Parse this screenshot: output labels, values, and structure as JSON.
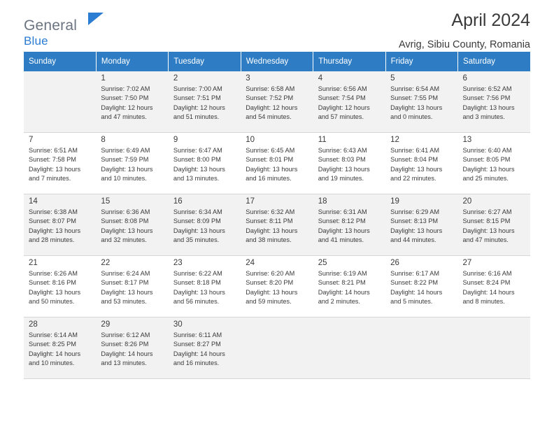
{
  "brand": {
    "name_part1": "General",
    "name_part2": "Blue",
    "flag_icon": "blue-flag-icon"
  },
  "header": {
    "title": "April 2024",
    "location": "Avrig, Sibiu County, Romania"
  },
  "calendar": {
    "weekday_headers": [
      "Sunday",
      "Monday",
      "Tuesday",
      "Wednesday",
      "Thursday",
      "Friday",
      "Saturday"
    ],
    "header_color": "#2e7dc4",
    "weeks": [
      [
        {
          "day": "",
          "info": ""
        },
        {
          "day": "1",
          "info": "Sunrise: 7:02 AM\nSunset: 7:50 PM\nDaylight: 12 hours\nand 47 minutes."
        },
        {
          "day": "2",
          "info": "Sunrise: 7:00 AM\nSunset: 7:51 PM\nDaylight: 12 hours\nand 51 minutes."
        },
        {
          "day": "3",
          "info": "Sunrise: 6:58 AM\nSunset: 7:52 PM\nDaylight: 12 hours\nand 54 minutes."
        },
        {
          "day": "4",
          "info": "Sunrise: 6:56 AM\nSunset: 7:54 PM\nDaylight: 12 hours\nand 57 minutes."
        },
        {
          "day": "5",
          "info": "Sunrise: 6:54 AM\nSunset: 7:55 PM\nDaylight: 13 hours\nand 0 minutes."
        },
        {
          "day": "6",
          "info": "Sunrise: 6:52 AM\nSunset: 7:56 PM\nDaylight: 13 hours\nand 3 minutes."
        }
      ],
      [
        {
          "day": "7",
          "info": "Sunrise: 6:51 AM\nSunset: 7:58 PM\nDaylight: 13 hours\nand 7 minutes."
        },
        {
          "day": "8",
          "info": "Sunrise: 6:49 AM\nSunset: 7:59 PM\nDaylight: 13 hours\nand 10 minutes."
        },
        {
          "day": "9",
          "info": "Sunrise: 6:47 AM\nSunset: 8:00 PM\nDaylight: 13 hours\nand 13 minutes."
        },
        {
          "day": "10",
          "info": "Sunrise: 6:45 AM\nSunset: 8:01 PM\nDaylight: 13 hours\nand 16 minutes."
        },
        {
          "day": "11",
          "info": "Sunrise: 6:43 AM\nSunset: 8:03 PM\nDaylight: 13 hours\nand 19 minutes."
        },
        {
          "day": "12",
          "info": "Sunrise: 6:41 AM\nSunset: 8:04 PM\nDaylight: 13 hours\nand 22 minutes."
        },
        {
          "day": "13",
          "info": "Sunrise: 6:40 AM\nSunset: 8:05 PM\nDaylight: 13 hours\nand 25 minutes."
        }
      ],
      [
        {
          "day": "14",
          "info": "Sunrise: 6:38 AM\nSunset: 8:07 PM\nDaylight: 13 hours\nand 28 minutes."
        },
        {
          "day": "15",
          "info": "Sunrise: 6:36 AM\nSunset: 8:08 PM\nDaylight: 13 hours\nand 32 minutes."
        },
        {
          "day": "16",
          "info": "Sunrise: 6:34 AM\nSunset: 8:09 PM\nDaylight: 13 hours\nand 35 minutes."
        },
        {
          "day": "17",
          "info": "Sunrise: 6:32 AM\nSunset: 8:11 PM\nDaylight: 13 hours\nand 38 minutes."
        },
        {
          "day": "18",
          "info": "Sunrise: 6:31 AM\nSunset: 8:12 PM\nDaylight: 13 hours\nand 41 minutes."
        },
        {
          "day": "19",
          "info": "Sunrise: 6:29 AM\nSunset: 8:13 PM\nDaylight: 13 hours\nand 44 minutes."
        },
        {
          "day": "20",
          "info": "Sunrise: 6:27 AM\nSunset: 8:15 PM\nDaylight: 13 hours\nand 47 minutes."
        }
      ],
      [
        {
          "day": "21",
          "info": "Sunrise: 6:26 AM\nSunset: 8:16 PM\nDaylight: 13 hours\nand 50 minutes."
        },
        {
          "day": "22",
          "info": "Sunrise: 6:24 AM\nSunset: 8:17 PM\nDaylight: 13 hours\nand 53 minutes."
        },
        {
          "day": "23",
          "info": "Sunrise: 6:22 AM\nSunset: 8:18 PM\nDaylight: 13 hours\nand 56 minutes."
        },
        {
          "day": "24",
          "info": "Sunrise: 6:20 AM\nSunset: 8:20 PM\nDaylight: 13 hours\nand 59 minutes."
        },
        {
          "day": "25",
          "info": "Sunrise: 6:19 AM\nSunset: 8:21 PM\nDaylight: 14 hours\nand 2 minutes."
        },
        {
          "day": "26",
          "info": "Sunrise: 6:17 AM\nSunset: 8:22 PM\nDaylight: 14 hours\nand 5 minutes."
        },
        {
          "day": "27",
          "info": "Sunrise: 6:16 AM\nSunset: 8:24 PM\nDaylight: 14 hours\nand 8 minutes."
        }
      ],
      [
        {
          "day": "28",
          "info": "Sunrise: 6:14 AM\nSunset: 8:25 PM\nDaylight: 14 hours\nand 10 minutes."
        },
        {
          "day": "29",
          "info": "Sunrise: 6:12 AM\nSunset: 8:26 PM\nDaylight: 14 hours\nand 13 minutes."
        },
        {
          "day": "30",
          "info": "Sunrise: 6:11 AM\nSunset: 8:27 PM\nDaylight: 14 hours\nand 16 minutes."
        },
        {
          "day": "",
          "info": ""
        },
        {
          "day": "",
          "info": ""
        },
        {
          "day": "",
          "info": ""
        },
        {
          "day": "",
          "info": ""
        }
      ]
    ]
  }
}
